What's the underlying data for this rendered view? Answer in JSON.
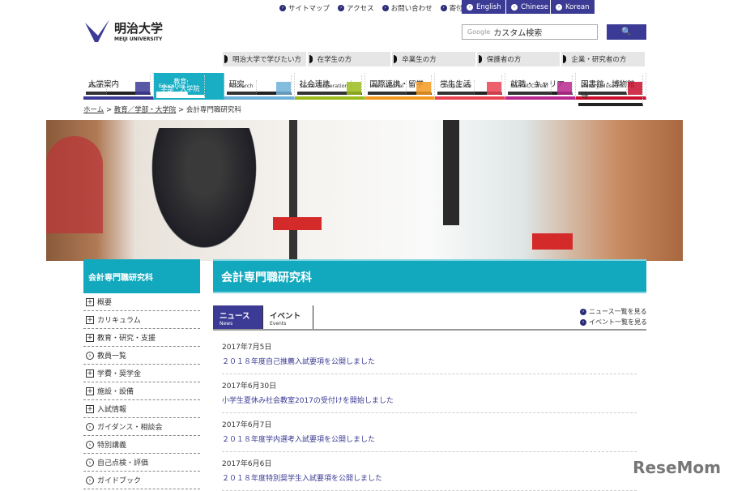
{
  "top_links": [
    "サイトマップ",
    "アクセス",
    "お問い合わせ",
    "寄付"
  ],
  "languages": [
    "English",
    "Chinese",
    "Korean"
  ],
  "logo": {
    "jp": "明治大学",
    "en": "MEIJI UNIVERSITY"
  },
  "search": {
    "prefix": "Google",
    "placeholder": "カスタム検索",
    "button": "🔍"
  },
  "audience": [
    "明治大学で学びたい方",
    "在学生の方",
    "卒業生の方",
    "保護者の方",
    "企業・研究者の方"
  ],
  "nav": [
    {
      "jp": "大学案内",
      "en": "About",
      "color": "#3b3b95"
    },
    {
      "jp": "教育\n学部・大学院",
      "en": "Education",
      "color": "#1aaec4"
    },
    {
      "jp": "研究",
      "en": "Research",
      "color": "#6fb0d8"
    },
    {
      "jp": "社会連携",
      "en": "Social cooperation",
      "color": "#9bbb1c"
    },
    {
      "jp": "国際連携・留学",
      "en": "International",
      "color": "#f39a1e"
    },
    {
      "jp": "学生生活",
      "en": "Campus life",
      "color": "#e94352"
    },
    {
      "jp": "就職・キャリア",
      "en": "Recruit/Career",
      "color": "#b8288f"
    },
    {
      "jp": "図書館・博物館等",
      "en": "Library/Museum",
      "color": "#c8102e"
    }
  ],
  "breadcrumb": [
    "ホーム",
    "教育／学部・大学院",
    "会計専門職研究科"
  ],
  "sidebar": {
    "title": "会計専門職研究科",
    "items": [
      {
        "label": "概要",
        "icon": "plus"
      },
      {
        "label": "カリキュラム",
        "icon": "plus"
      },
      {
        "label": "教育・研究・支援",
        "icon": "plus"
      },
      {
        "label": "教員一覧",
        "icon": "arrow"
      },
      {
        "label": "学費・奨学金",
        "icon": "plus"
      },
      {
        "label": "施設・設備",
        "icon": "plus"
      },
      {
        "label": "入試情報",
        "icon": "plus"
      },
      {
        "label": "ガイダンス・相談会",
        "icon": "arrow"
      },
      {
        "label": "特別講義",
        "icon": "arrow"
      },
      {
        "label": "自己点検・評価",
        "icon": "arrow"
      },
      {
        "label": "ガイドブック",
        "icon": "arrow"
      }
    ]
  },
  "main": {
    "title": "会計専門職研究科",
    "tabs": [
      {
        "jp": "ニュース",
        "en": "News"
      },
      {
        "jp": "イベント",
        "en": "Events"
      }
    ],
    "more_links": [
      "ニュース一覧を見る",
      "イベント一覧を見る"
    ],
    "news": [
      {
        "date": "2017年7月5日",
        "title": "２０１８年度自己推薦入試要項を公開しました"
      },
      {
        "date": "2017年6月30日",
        "title": "小学生夏休み社会教室2017の受付けを開始しました"
      },
      {
        "date": "2017年6月7日",
        "title": "２０１８年度学内選考入試要項を公開しました"
      },
      {
        "date": "2017年6月6日",
        "title": "２０１８年度特別奨学生入試要項を公開しました"
      }
    ]
  },
  "watermark": "ReseMom"
}
